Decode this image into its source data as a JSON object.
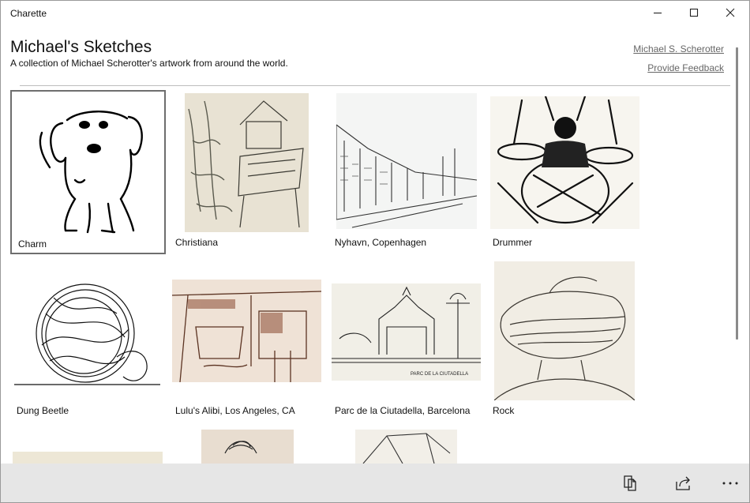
{
  "window": {
    "title": "Charette"
  },
  "header": {
    "title": "Michael's Sketches",
    "subtitle": "A collection of Michael Scherotter's artwork from around the world.",
    "author_link": "Michael S. Scherotter",
    "feedback_link": "Provide Feedback"
  },
  "gallery": {
    "items": [
      {
        "label": "Charm"
      },
      {
        "label": "Christiana"
      },
      {
        "label": "Nyhavn, Copenhagen"
      },
      {
        "label": "Drummer"
      },
      {
        "label": "Dung Beetle"
      },
      {
        "label": "Lulu's Alibi, Los Angeles, CA"
      },
      {
        "label": "Parc de la Ciutadella, Barcelona"
      },
      {
        "label": "Rock"
      }
    ],
    "sketch_caption": "PARC DE LA CIUTADELLA"
  },
  "commandbar": {
    "icons": [
      "copy-icon",
      "share-icon",
      "more-icon"
    ]
  }
}
